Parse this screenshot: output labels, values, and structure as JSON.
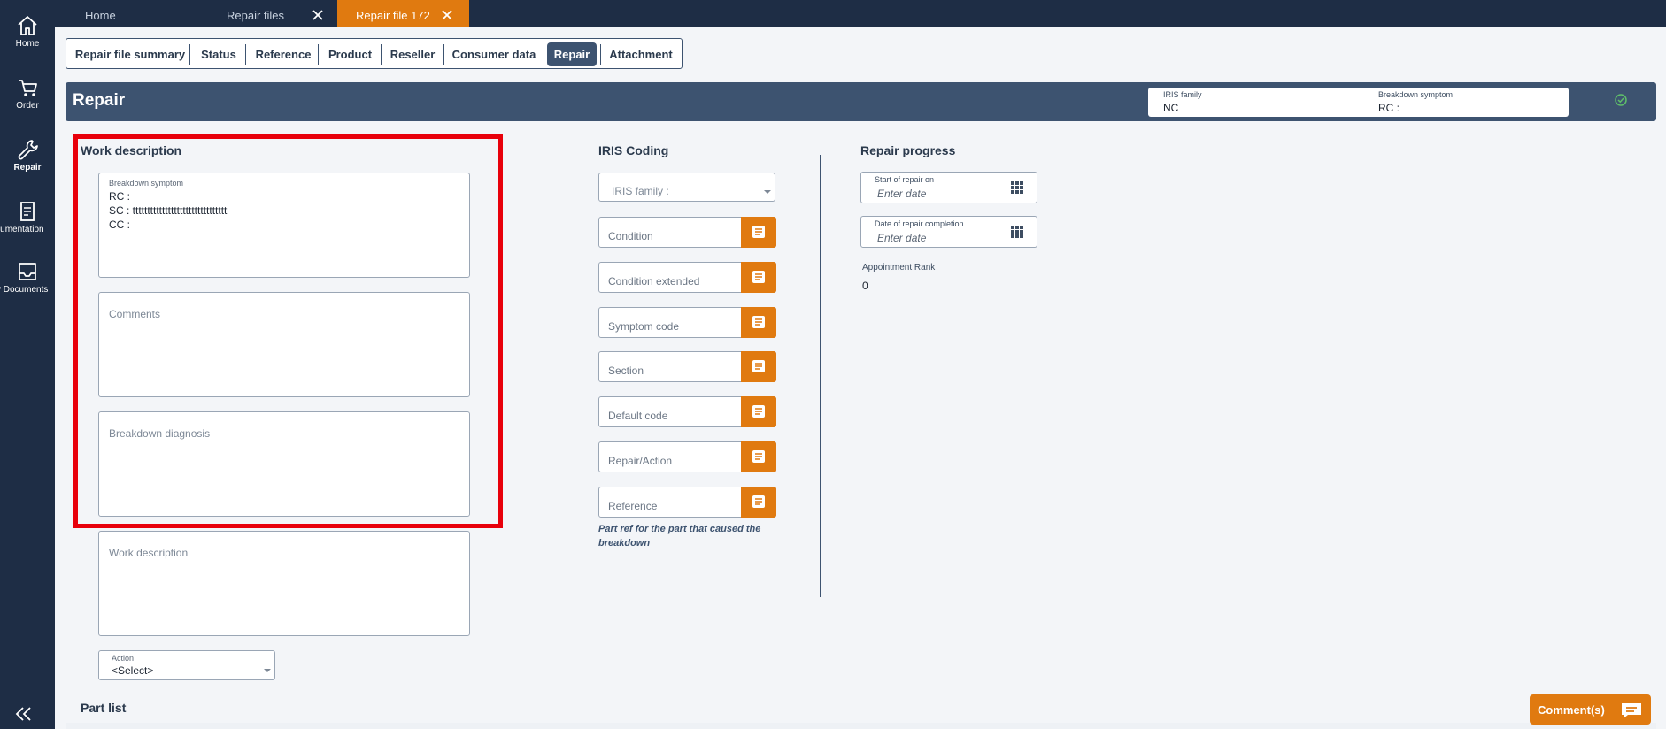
{
  "sidebar": {
    "items": [
      {
        "label": "Home",
        "icon": "home-icon"
      },
      {
        "label": "Order",
        "icon": "cart-icon"
      },
      {
        "label": "Repair",
        "icon": "wrench-icon"
      },
      {
        "label": "Documentation",
        "icon": "document-icon"
      },
      {
        "label": "My Documents",
        "icon": "inbox-icon"
      }
    ],
    "collapse_icon": "double-chevron-left-icon"
  },
  "top_tabs": [
    {
      "label": "Home"
    },
    {
      "label": "Repair files",
      "closable": true
    },
    {
      "label": "Repair file 172",
      "closable": true,
      "active": true
    }
  ],
  "sub_tabs": [
    {
      "label": "Repair file summary"
    },
    {
      "label": "Status"
    },
    {
      "label": "Reference"
    },
    {
      "label": "Product"
    },
    {
      "label": "Reseller"
    },
    {
      "label": "Consumer data"
    },
    {
      "label": "Repair",
      "active": true
    },
    {
      "label": "Attachment"
    }
  ],
  "header": {
    "title": "Repair",
    "iris_family_label": "IRIS family",
    "iris_family_value": "NC",
    "breakdown_symptom_label": "Breakdown symptom",
    "breakdown_symptom_value": "RC :",
    "status_icon": "check-circle-icon"
  },
  "work_description": {
    "title": "Work description",
    "breakdown_symptom": {
      "label": "Breakdown symptom",
      "lines": [
        "RC :",
        "SC : tttttttttttttttttttttttttttttttt",
        "CC :"
      ]
    },
    "comments_placeholder": "Comments",
    "breakdown_diagnosis_placeholder": "Breakdown diagnosis",
    "work_description_placeholder": "Work description",
    "action": {
      "label": "Action",
      "value": "<Select>"
    }
  },
  "iris_coding": {
    "title": "IRIS Coding",
    "family_placeholder": "IRIS family :",
    "fields": [
      "Condition",
      "Condition extended",
      "Symptom code",
      "Section",
      "Default code",
      "Repair/Action",
      "Reference"
    ],
    "note": "Part ref for the part that caused the breakdown"
  },
  "repair_progress": {
    "title": "Repair progress",
    "start_label": "Start of repair on",
    "start_placeholder": "Enter date",
    "completion_label": "Date of repair completion",
    "completion_placeholder": "Enter date",
    "appointment_rank_label": "Appointment Rank",
    "appointment_rank_value": "0"
  },
  "part_list": {
    "title": "Part list"
  },
  "comments_button": {
    "label": "Comment(s)",
    "icon": "chat-icon"
  },
  "colors": {
    "nav": "#1e2d45",
    "accent": "#e07a10",
    "band": "#3d5370",
    "highlight": "#e8000b"
  }
}
